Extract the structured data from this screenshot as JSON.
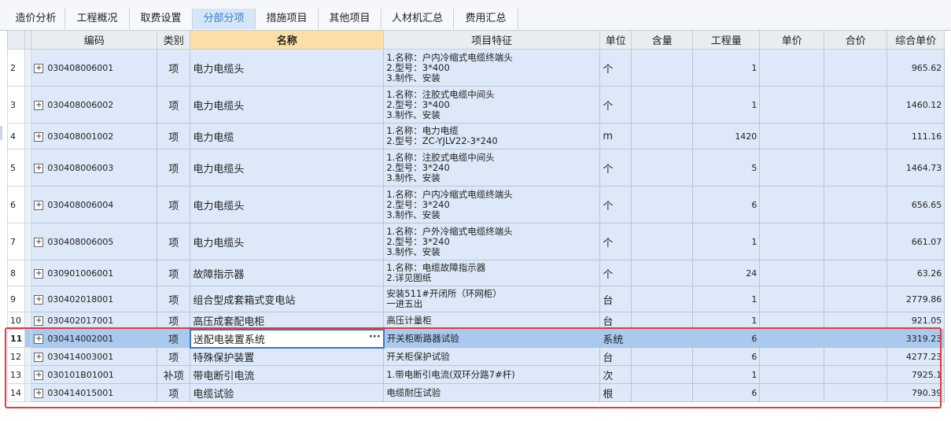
{
  "tabs": [
    {
      "label": "造价分析"
    },
    {
      "label": "工程概况"
    },
    {
      "label": "取费设置"
    },
    {
      "label": "分部分项"
    },
    {
      "label": "措施项目"
    },
    {
      "label": "其他项目"
    },
    {
      "label": "人材机汇总"
    },
    {
      "label": "费用汇总"
    }
  ],
  "active_tab": "分部分项",
  "columns": {
    "code": "编码",
    "type": "类别",
    "name": "名称",
    "feature": "项目特征",
    "unit": "单位",
    "content": "含量",
    "qty": "工程量",
    "price": "单价",
    "total": "合价",
    "unit_price": "综合单价"
  },
  "rows": [
    {
      "no": "2",
      "code": "030408006001",
      "type": "项",
      "name": "电力电缆头",
      "features": [
        "1.名称：户内冷缩式电缆终端头",
        "2.型号：3*400",
        "3.制作、安装"
      ],
      "unit": "个",
      "qty": "1",
      "unit_price": "965.62"
    },
    {
      "no": "3",
      "code": "030408006002",
      "type": "项",
      "name": "电力电缆头",
      "features": [
        "1.名称：注胶式电缆中间头",
        "2.型号：3*400",
        "3.制作、安装"
      ],
      "unit": "个",
      "qty": "1",
      "unit_price": "1460.12"
    },
    {
      "no": "4",
      "code": "030408001002",
      "type": "项",
      "name": "电力电缆",
      "features": [
        "1.名称：电力电缆",
        "2.型号：ZC-YJLV22-3*240"
      ],
      "unit": "m",
      "qty": "1420",
      "unit_price": "111.16"
    },
    {
      "no": "5",
      "code": "030408006003",
      "type": "项",
      "name": "电力电缆头",
      "features": [
        "1.名称：注胶式电缆中间头",
        "2.型号：3*240",
        "3.制作、安装"
      ],
      "unit": "个",
      "qty": "5",
      "unit_price": "1464.73"
    },
    {
      "no": "6",
      "code": "030408006004",
      "type": "项",
      "name": "电力电缆头",
      "features": [
        "1.名称：户内冷缩式电缆终端头",
        "2.型号：3*240",
        "3.制作、安装"
      ],
      "unit": "个",
      "qty": "6",
      "unit_price": "656.65"
    },
    {
      "no": "7",
      "code": "030408006005",
      "type": "项",
      "name": "电力电缆头",
      "features": [
        "1.名称：户外冷缩式电缆终端头",
        "2.型号：3*240",
        "3.制作、安装"
      ],
      "unit": "个",
      "qty": "1",
      "unit_price": "661.07"
    },
    {
      "no": "8",
      "code": "030901006001",
      "type": "项",
      "name": "故障指示器",
      "features": [
        "1.名称：电缆故障指示器",
        "2.详见图纸"
      ],
      "unit": "个",
      "qty": "24",
      "unit_price": "63.26"
    },
    {
      "no": "9",
      "code": "030402018001",
      "type": "项",
      "name": "组合型成套箱式变电站",
      "features": [
        "安装511#开闭所（环网柜）",
        "一进五出"
      ],
      "unit": "台",
      "qty": "1",
      "unit_price": "2779.86"
    },
    {
      "no": "10",
      "code": "030402017001",
      "type": "项",
      "name": "高压成套配电柜",
      "features": [
        "高压计量柜"
      ],
      "unit": "台",
      "qty": "1",
      "unit_price": "921.05"
    },
    {
      "no": "11",
      "code": "030414002001",
      "type": "项",
      "name": "送配电装置系统",
      "features": [
        "开关柜断路器试验"
      ],
      "unit": "系统",
      "qty": "6",
      "unit_price": "3319.23"
    },
    {
      "no": "12",
      "code": "030414003001",
      "type": "项",
      "name": "特殊保护装置",
      "features": [
        "开关柜保护试验"
      ],
      "unit": "台",
      "qty": "6",
      "unit_price": "4277.23"
    },
    {
      "no": "13",
      "code": "030101B01001",
      "type": "补项",
      "name": "带电断引电流",
      "features": [
        "1.带电断引电流(双环分路7#杆)"
      ],
      "unit": "次",
      "qty": "1",
      "unit_price": "7925.1"
    },
    {
      "no": "14",
      "code": "030414015001",
      "type": "项",
      "name": "电缆试验",
      "features": [
        "电缆耐压试验"
      ],
      "unit": "根",
      "qty": "6",
      "unit_price": "790.39"
    }
  ],
  "selected_row": "11",
  "highlight_color": "#e23b3b",
  "selection_color": "#2f7ad6"
}
